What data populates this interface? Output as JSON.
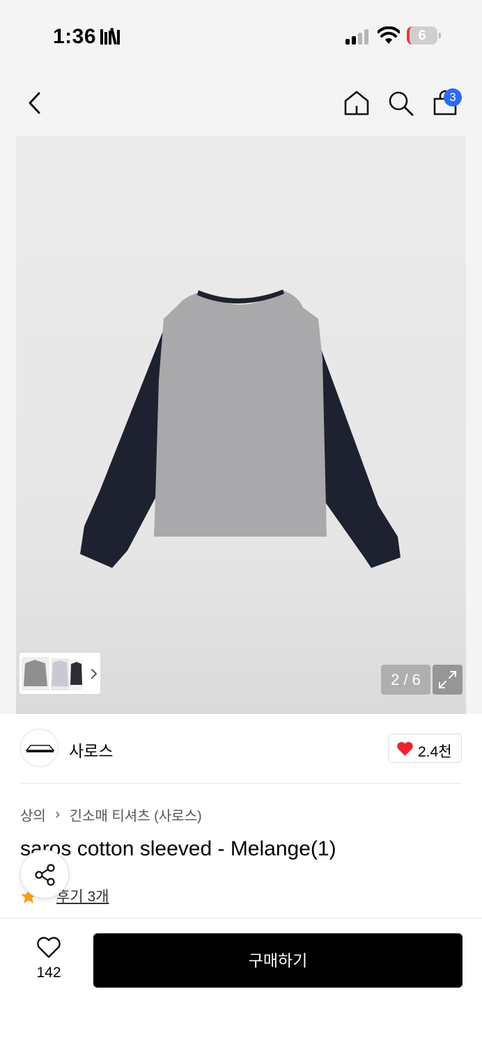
{
  "status_bar": {
    "time": "1:36",
    "battery_level": "6"
  },
  "nav": {
    "cart_badge": "3"
  },
  "gallery": {
    "page_indicator": "2 / 6"
  },
  "brand": {
    "name": "사로스",
    "like_count": "2.4천"
  },
  "product": {
    "breadcrumb": [
      "상의",
      "긴소매 티셔츠 (사로스)"
    ],
    "title": "saros cotton sleeved - Melange(1)",
    "review_link": "후기 3개"
  },
  "bottom_bar": {
    "wish_count": "142",
    "buy_label": "구매하기"
  },
  "colors": {
    "accent_blue": "#2c6bf0",
    "heart_red": "#e8262e",
    "star_orange": "#f7a21b",
    "buy_button": "#000000"
  }
}
